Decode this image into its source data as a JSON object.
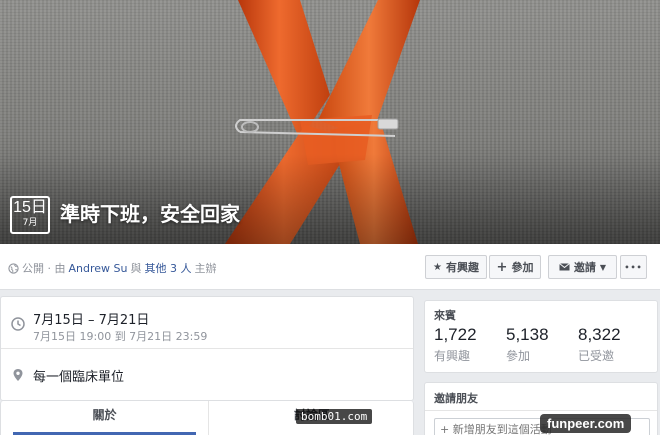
{
  "cover": {
    "date_day": "15日",
    "date_month": "7月",
    "title": "準時下班，安全回家"
  },
  "host": {
    "prefix": "公開 · 由",
    "name": "Andrew Su",
    "middle": "與",
    "others": "其他 3 人",
    "suffix": "主辦"
  },
  "actions": {
    "interested_label": "有興趣",
    "join_label": "參加",
    "invite_label": "邀請",
    "more_label": "•••"
  },
  "details": {
    "date_range": "7月15日 – 7月21日",
    "date_detail": "7月15日 19:00 到 7月21日 23:59",
    "location": "每一個臨床單位"
  },
  "tabs": [
    {
      "label": "關於"
    },
    {
      "label": "討論區"
    }
  ],
  "guests": {
    "header": "來賓",
    "stats": [
      {
        "value": "1,722",
        "label": "有興趣"
      },
      {
        "value": "5,138",
        "label": "參加"
      },
      {
        "value": "8,322",
        "label": "已受邀"
      }
    ]
  },
  "invite": {
    "header": "邀請朋友",
    "placeholder": "+ 新增朋友到這個活動"
  },
  "watermarks": {
    "bomb": "bomb01.com",
    "funpeer": "funpeer.com"
  },
  "colors": {
    "link": "#365899",
    "ribbon": "#e0541c",
    "tab_accent": "#4267b2"
  },
  "icons": [
    "globe-icon",
    "star-icon",
    "plus-icon",
    "envelope-icon",
    "chevron-down-icon",
    "clock-icon",
    "map-pin-icon"
  ]
}
